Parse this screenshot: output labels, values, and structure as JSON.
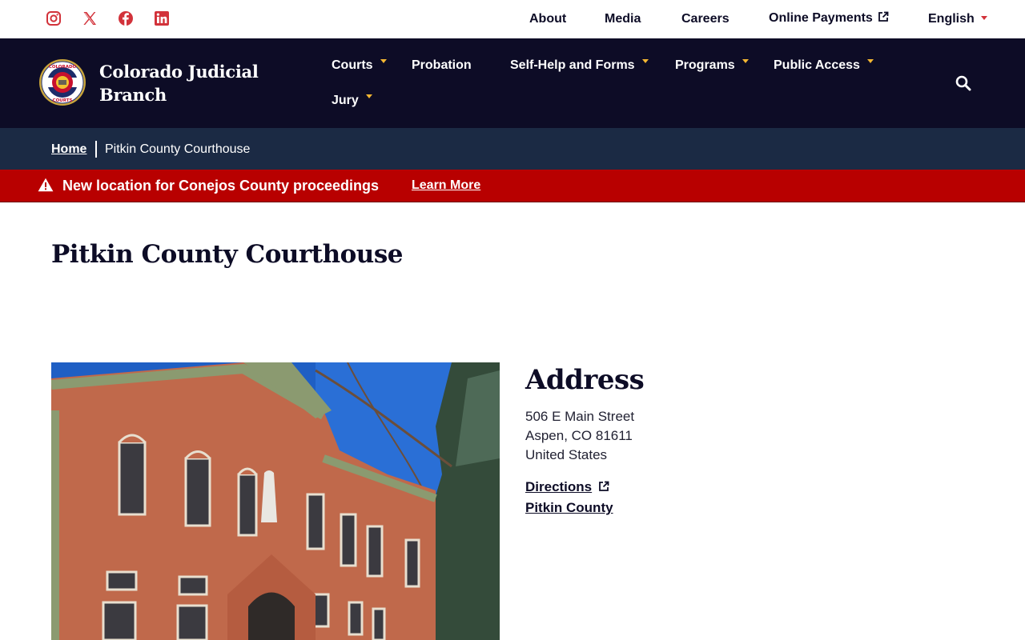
{
  "utility": {
    "social": [
      "instagram-icon",
      "x-icon",
      "facebook-icon",
      "linkedin-icon"
    ],
    "links": {
      "about": "About",
      "media": "Media",
      "careers": "Careers",
      "online_payments": "Online Payments",
      "language": "English"
    }
  },
  "header": {
    "brand_line1": "Colorado Judicial",
    "brand_line2": "Branch",
    "nav": {
      "courts": "Courts",
      "probation": "Probation",
      "self_help": "Self-Help and Forms",
      "programs": "Programs",
      "public_access": "Public Access",
      "jury": "Jury"
    }
  },
  "breadcrumb": {
    "home": "Home",
    "current": "Pitkin County Courthouse"
  },
  "alert": {
    "text": "New location for Conejos County proceedings",
    "link": "Learn More"
  },
  "page": {
    "title": "Pitkin County Courthouse"
  },
  "address": {
    "heading": "Address",
    "street": "506 E Main Street",
    "city": "Aspen, CO 81611",
    "country": "United States",
    "directions": "Directions",
    "county": "Pitkin County"
  },
  "colors": {
    "navy": "#0d0c26",
    "breadcrumb": "#1b2a44",
    "alert_red": "#b80000",
    "accent_yellow": "#f2b632",
    "social_red": "#d2323a"
  }
}
